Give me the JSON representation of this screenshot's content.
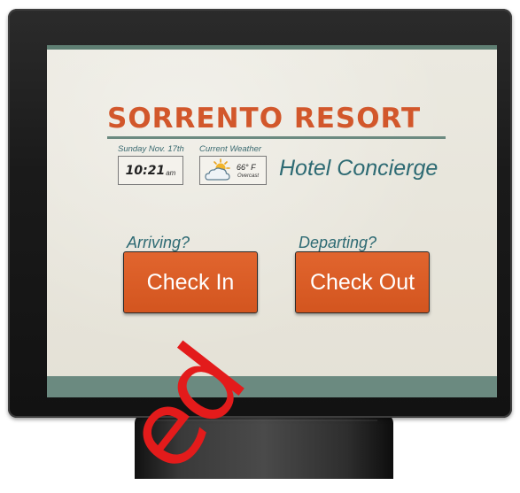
{
  "kiosk": {
    "brand": "SORRENTO RESORT",
    "date_label": "Sunday Nov. 17th",
    "clock": {
      "time": "10:21",
      "ampm": "am"
    },
    "weather": {
      "label": "Current Weather",
      "temp": "66° F",
      "condition": "Overcast",
      "icon": "partly-cloudy-icon"
    },
    "subtitle": "Hotel Concierge",
    "arrive_prompt": "Arriving?",
    "depart_prompt": "Departing?",
    "check_in_label": "Check In",
    "check_out_label": "Check Out"
  },
  "colors": {
    "brand_orange": "#d2572b",
    "teal_text": "#2d6a73",
    "button_orange": "#e1652e",
    "footer_green": "#6b8a80",
    "screen_bg": "#e8e5db"
  },
  "watermark": {
    "text": "ed",
    "color": "#e31b1b"
  }
}
